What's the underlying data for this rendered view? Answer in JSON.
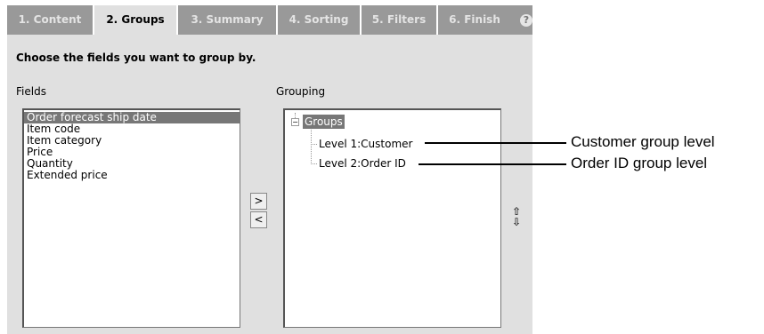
{
  "tabs": [
    {
      "label": "1. Content",
      "active": false
    },
    {
      "label": "2. Groups",
      "active": true
    },
    {
      "label": "3. Summary",
      "active": false
    },
    {
      "label": "4. Sorting",
      "active": false
    },
    {
      "label": "5. Filters",
      "active": false
    },
    {
      "label": "6. Finish",
      "active": false
    }
  ],
  "help_icon": "?",
  "instruction": "Choose the fields you want to group by.",
  "fields": {
    "label": "Fields",
    "items": [
      {
        "label": "Order forecast ship date",
        "selected": true
      },
      {
        "label": "Item code",
        "selected": false
      },
      {
        "label": "Item category",
        "selected": false
      },
      {
        "label": "Price",
        "selected": false
      },
      {
        "label": "Quantity",
        "selected": false
      },
      {
        "label": "Extended price",
        "selected": false
      }
    ]
  },
  "buttons": {
    "add": ">",
    "remove": "<"
  },
  "grouping": {
    "label": "Grouping",
    "root": "Groups",
    "expander": "−",
    "levels": [
      "Level 1:Customer",
      "Level 2:Order ID"
    ]
  },
  "move_up": "⇧",
  "move_down": "⇩",
  "callouts": [
    "Customer group level",
    "Order ID group level"
  ],
  "colors": {
    "tab_bar": "#999999",
    "panel": "#e0e0e0",
    "selection": "#777777"
  }
}
